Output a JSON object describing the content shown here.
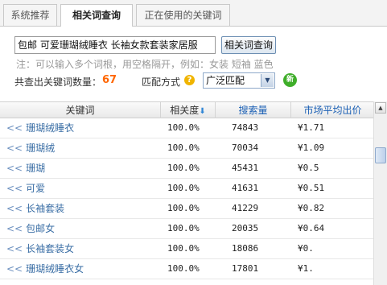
{
  "tabs": [
    {
      "label": "系统推荐",
      "active": false
    },
    {
      "label": "相关词查询",
      "active": true
    },
    {
      "label": "正在使用的关键词",
      "active": false
    }
  ],
  "query": {
    "value": "包邮 可爱珊瑚绒睡衣 长袖女款套装家居服",
    "button_label": "相关词查询"
  },
  "hint": "注：可以输入多个词根，用空格隔开，例如：女装 短袖 蓝色",
  "summary": {
    "count_label": "共查出关键词数量：",
    "count_value": "67",
    "match_label": "匹配方式",
    "match_value": "广泛匹配",
    "new_badge": "新"
  },
  "table": {
    "headers": {
      "keyword": "关键词",
      "relevance": "相关度",
      "search": "搜索量",
      "price": "市场平均出价"
    },
    "rows": [
      {
        "keyword": "珊瑚绒睡衣",
        "relevance": "100.0%",
        "search": "74843",
        "price": "¥1.71"
      },
      {
        "keyword": "珊瑚绒",
        "relevance": "100.0%",
        "search": "70034",
        "price": "¥1.09"
      },
      {
        "keyword": "珊瑚",
        "relevance": "100.0%",
        "search": "45431",
        "price": "¥0.5"
      },
      {
        "keyword": "可爱",
        "relevance": "100.0%",
        "search": "41631",
        "price": "¥0.51"
      },
      {
        "keyword": "长袖套装",
        "relevance": "100.0%",
        "search": "41229",
        "price": "¥0.82"
      },
      {
        "keyword": "包邮女",
        "relevance": "100.0%",
        "search": "20035",
        "price": "¥0.64"
      },
      {
        "keyword": "长袖套装女",
        "relevance": "100.0%",
        "search": "18086",
        "price": "¥0."
      },
      {
        "keyword": "珊瑚绒睡衣女",
        "relevance": "100.0%",
        "search": "17801",
        "price": "¥1."
      }
    ]
  },
  "icons": {
    "help": "help-icon",
    "sort": "sort-down-icon",
    "row_prefix": "double-chevron-left-icon",
    "select_arrow": "chevron-down-icon"
  }
}
